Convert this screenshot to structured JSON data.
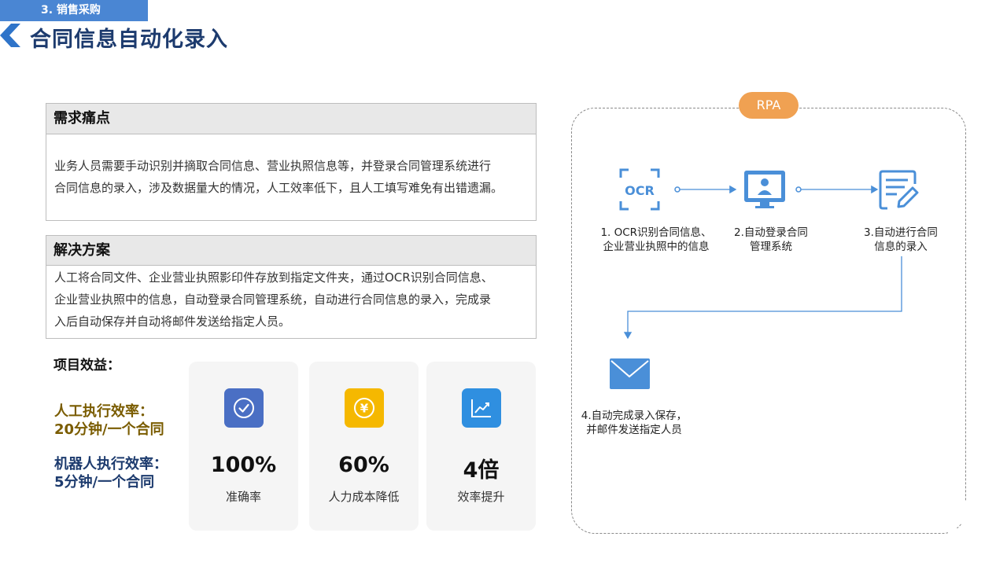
{
  "header": {
    "section_tag": "3. 销售采购",
    "title": "合同信息自动化录入"
  },
  "pain_points": {
    "heading": "需求痛点",
    "lines": [
      "业务人员需要手动识别并摘取合同信息、营业执照信息等，并登录合同管理系统进行",
      "合同信息的录入，涉及数据量大的情况，人工效率低下，且人工填写难免有出错遗漏。"
    ]
  },
  "solution": {
    "heading": "解决方案",
    "lines": [
      "人工将合同文件、企业营业执照影印件存放到指定文件夹，通过OCR识别合同信息、",
      "企业营业执照中的信息，自动登录合同管理系统，自动进行合同信息的录入，完成录",
      "入后自动保存并自动将邮件发送给指定人员。"
    ]
  },
  "benefits": {
    "heading": "项目效益：",
    "manual": {
      "line1": "人工执行效率：",
      "line2": "20分钟/一个合同"
    },
    "robot": {
      "line1": "机器人执行效率：",
      "line2": "5分钟/一个合同"
    },
    "cards": [
      {
        "value": "100%",
        "label": "准确率",
        "icon": "check-circle-icon",
        "color": "#4a6fc4"
      },
      {
        "value": "60%",
        "label": "人力成本降低",
        "icon": "yen-coin-icon",
        "color": "#f5b800"
      },
      {
        "value": "4倍",
        "label": "效率提升",
        "icon": "trend-chart-icon",
        "color": "#2f8fe0"
      }
    ]
  },
  "flow": {
    "badge": "RPA",
    "steps": [
      {
        "line1": "1. OCR识别合同信息、",
        "line2": "企业营业执照中的信息",
        "icon": "ocr-scan-icon"
      },
      {
        "line1": "2.自动登录合同",
        "line2": "管理系统",
        "icon": "monitor-user-icon"
      },
      {
        "line1": "3.自动进行合同",
        "line2": "信息的录入",
        "icon": "form-edit-icon"
      },
      {
        "line1": "4.自动完成录入保存，",
        "line2": "并邮件发送指定人员",
        "icon": "mail-envelope-icon"
      }
    ],
    "ocr_icon_text": "OCR",
    "colors": {
      "icon_blue": "#4a8fd8",
      "accent_orange": "#f0a152"
    }
  }
}
